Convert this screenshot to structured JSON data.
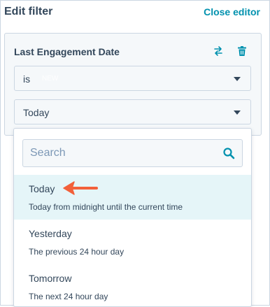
{
  "header": {
    "title": "Edit filter",
    "close_label": "Close editor"
  },
  "filter_card": {
    "property_name": "Last Engagement Date",
    "operator": {
      "value": "is",
      "ghost_text": "NEW"
    },
    "date_select": {
      "value": "Today"
    }
  },
  "dropdown": {
    "search": {
      "placeholder": "Search",
      "value": ""
    },
    "options": [
      {
        "label": "Today",
        "description": "Today from midnight until the current time",
        "selected": true
      },
      {
        "label": "Yesterday",
        "description": "The previous 24 hour day",
        "selected": false
      },
      {
        "label": "Tomorrow",
        "description": "The next 24 hour day",
        "selected": false
      }
    ]
  },
  "colors": {
    "accent": "#0091ae",
    "text": "#33475b",
    "selected_bg": "#e5f5f8",
    "arrow": "#f2603a"
  },
  "icons": [
    "swap-icon",
    "trash-icon",
    "search-icon",
    "caret-down-icon",
    "arrow-pointer-icon"
  ]
}
